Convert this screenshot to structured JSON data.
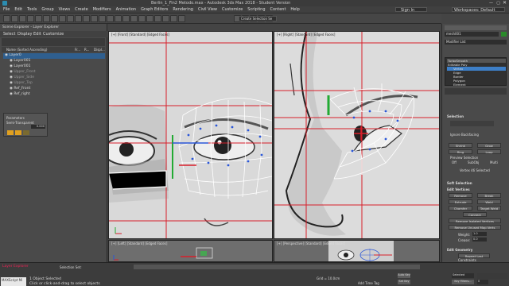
{
  "window": {
    "title": "Berlin_1_Fin2 Metodo.max - Autodesk 3ds Max 2018 - Student Version"
  },
  "menu": [
    "File",
    "Edit",
    "Tools",
    "Group",
    "Views",
    "Create",
    "Modifiers",
    "Animation",
    "Graph Editors",
    "Rendering",
    "Civil View",
    "Customize",
    "Scripting",
    "Content",
    "Help"
  ],
  "signin": "Sign In",
  "workspace": "Workspaces: Default",
  "toolbar": {
    "selection_set": "Create Selection Se"
  },
  "scene_explorer": {
    "title": "Scene Explorer - Layer Explorer",
    "tabs": [
      "Select",
      "Display",
      "Edit",
      "Customize"
    ],
    "columns": [
      "Name (Sorted Ascending)",
      "Fr...",
      "R...",
      "Displ..."
    ],
    "items": [
      "Layer0",
      "Layer001",
      "Layer001",
      "Upper_Front",
      "Upper_Side",
      "Upper_Top",
      "Ref_Front",
      "Ref_right"
    ],
    "footer": "Layer Explorer",
    "selection_set": "Selection Set:"
  },
  "float_panel": {
    "row1": "Parameters",
    "row2": "Semi-Transparent",
    "value": "0.000"
  },
  "viewports": {
    "front": "[+] [Front] [Standard] [Edged Faces]",
    "right": "[+] [Right] [Standard] [Edged Faces]",
    "left": "[+] [Left] [Standard] [Edged Faces]",
    "persp": "[+] [Perspective] [Standard] [Edged Faces]"
  },
  "command_panel": {
    "object_name": "mesh001",
    "modifier_list": "Modifier List",
    "stack": [
      "TurboSmooth",
      "Editable Poly",
      "Vertex",
      "Edge",
      "Border",
      "Polygon",
      "Element"
    ],
    "selection_title": "Selection",
    "ignore_backfacing": "Ignore Backfacing",
    "shrink": "Shrink",
    "grow": "Grow",
    "ring": "Ring",
    "loop": "Loop",
    "preview_selection": "Preview Selection",
    "preview_opts": [
      "Off",
      "SubObj",
      "Multi"
    ],
    "selected_info": "Vertex 46 Selected",
    "soft_selection": "Soft Selection",
    "edit_vertices": "Edit Vertices",
    "remove": "Remove",
    "break": "Break",
    "extrude": "Extrude",
    "weld": "Weld",
    "chamfer": "Chamfer",
    "target_weld": "Target Weld",
    "connect": "Connect",
    "remove_isolated": "Remove Isolated Vertices",
    "remove_unused": "Remove Unused Map Verts",
    "weight_label": "Weight:",
    "weight_value": "1.0",
    "crease_label": "Crease:",
    "crease_value": "0.0",
    "edit_geometry": "Edit Geometry",
    "repeat_last": "Repeat Last",
    "constraints": "Constraints",
    "constraint_opts": [
      "None",
      "Edge"
    ]
  },
  "status": {
    "selected": "1 Object Selected",
    "hint": "Click or click-and-drag to select objects",
    "script_label": "MAXScript Mi",
    "grid": "Grid = 10.0cm",
    "add_time_tag": "Add Time Tag",
    "autokey": "Auto Key",
    "selected_dropdown": "Selected",
    "set_key": "Set Key",
    "key_filters": "Key Filters...",
    "frame": "0"
  },
  "colors": {
    "accent": "#3d7fc8",
    "grid_red": "#d81f2a",
    "mesh_line": "#ffffff",
    "vertex": "#2a56d8"
  }
}
